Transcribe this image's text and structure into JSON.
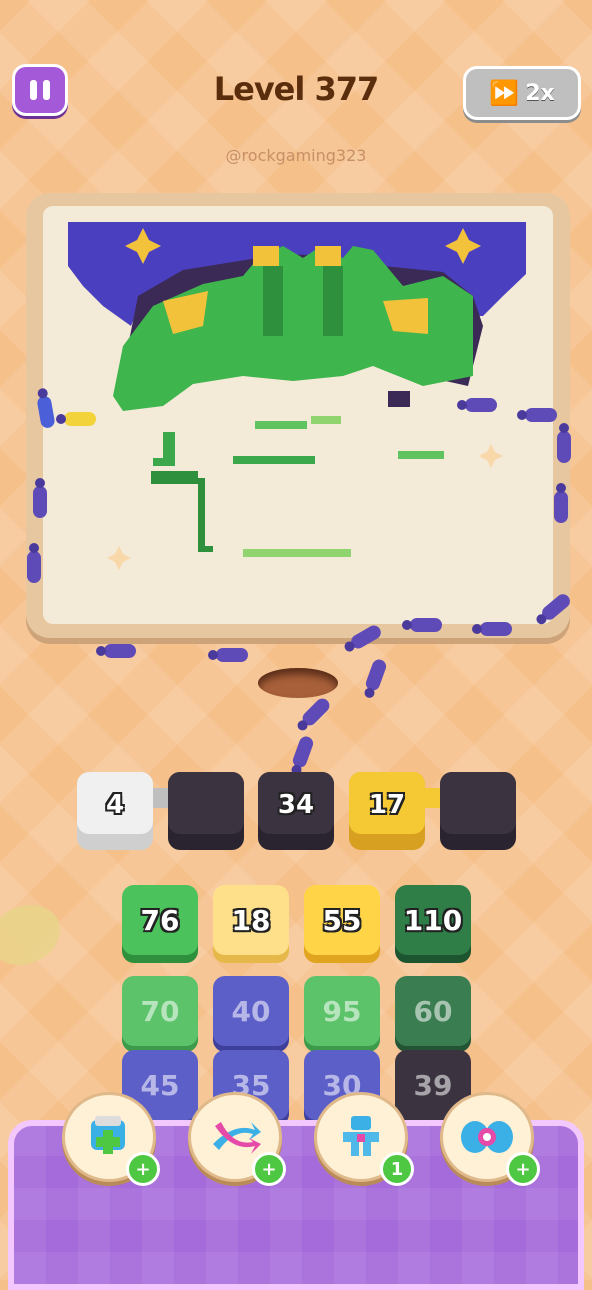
{
  "header": {
    "title": "Level 377",
    "speed_label": "2x",
    "watermark": "@rockgaming323"
  },
  "icons": {
    "pause": "pause-icon",
    "fast_forward": "fast-forward-icon",
    "booster_1": "add-box-booster-icon",
    "booster_2": "shuffle-arrows-booster-icon",
    "booster_3": "magnet-claw-booster-icon",
    "booster_4": "bow-booster-icon"
  },
  "slots": [
    {
      "value": "4",
      "color": "#e9e9e9"
    },
    {
      "value": "",
      "color": "#3b3340"
    },
    {
      "value": "34",
      "color": "#3b3340"
    },
    {
      "value": "17",
      "color": "#f5c934"
    },
    {
      "value": "",
      "color": "#3b3340"
    }
  ],
  "grid": {
    "rows": [
      [
        {
          "value": "76",
          "color": "#4cc25c",
          "active": true
        },
        {
          "value": "18",
          "color": "#ffe08a",
          "active": true
        },
        {
          "value": "55",
          "color": "#ffd447",
          "active": true
        },
        {
          "value": "110",
          "color": "#2f7d47",
          "active": true
        }
      ],
      [
        {
          "value": "70",
          "color": "#5dc36b",
          "active": false
        },
        {
          "value": "40",
          "color": "#5d5fc9",
          "active": false
        },
        {
          "value": "95",
          "color": "#5dc36b",
          "active": false
        },
        {
          "value": "60",
          "color": "#3a7d50",
          "active": false
        }
      ],
      [
        {
          "value": "45",
          "color": "#5d5fc9",
          "active": false
        },
        {
          "value": "35",
          "color": "#5d5fc9",
          "active": false
        },
        {
          "value": "30",
          "color": "#5d5fc9",
          "active": false
        },
        {
          "value": "39",
          "color": "#3b3340",
          "active": false
        }
      ]
    ]
  },
  "boosters": [
    {
      "badge": "+"
    },
    {
      "badge": "+"
    },
    {
      "badge": "1"
    },
    {
      "badge": "+"
    }
  ],
  "colors": {
    "purple_accent": "#a45ad8",
    "board_frame": "#e7c79f",
    "ant": "#5e4bb8"
  }
}
